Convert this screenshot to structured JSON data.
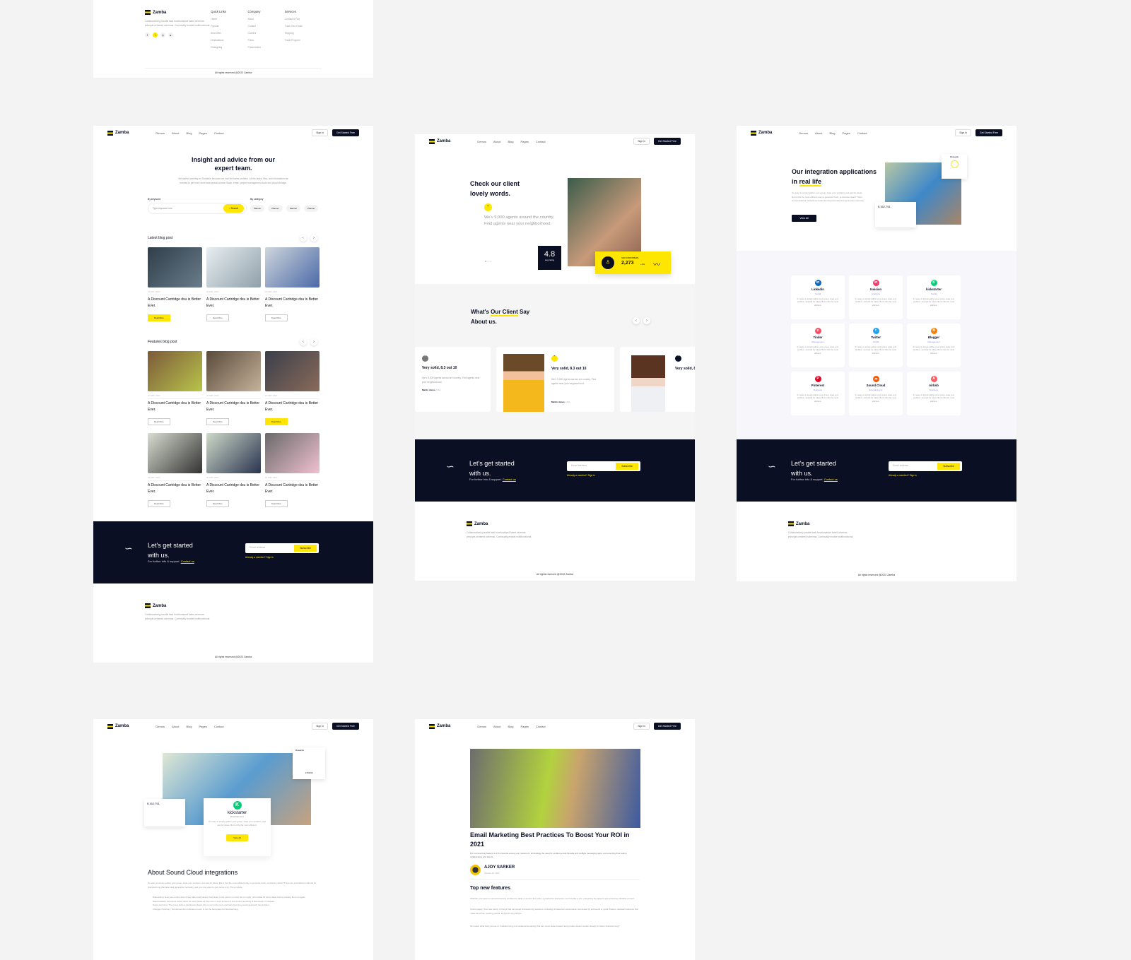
{
  "brand": "Zamba",
  "nav": {
    "links": [
      "Demos",
      "About",
      "Blog",
      "Pages",
      "Contact"
    ],
    "sign_in": "Sign in",
    "get_started": "Get Started Free"
  },
  "footer": {
    "desc": "Collaboratively parallel task functionalized talent whereas principle-centered schemas. Continually enable multifunctional.",
    "socials": [
      "f",
      "t",
      "ig",
      "yt"
    ],
    "cols": [
      {
        "title": "Quick Links",
        "items": [
          "Home",
          "Popular",
          "Best Offer",
          "Destinations",
          "Changelog"
        ]
      },
      {
        "title": "Company",
        "items": [
          "About",
          "Contact",
          "Careers",
          "Press",
          "Presentation"
        ]
      },
      {
        "title": "Services",
        "items": [
          "Contact & Faq",
          "Track Your Order",
          "Shipping",
          "Trade Program"
        ]
      }
    ],
    "copyright": "All rights reserved @2022 Zamba"
  },
  "cta": {
    "title_line1": "Let's get started",
    "title_line2": "with us.",
    "support": "For furthur info & support.",
    "contact_link": "Contact us",
    "email_placeholder": "Email address",
    "subscribe": "Subscribe",
    "member": "Already a member? Sign in"
  },
  "blog": {
    "title": "Insight and advice from our expert team.",
    "desc": "We started working on Taskable because we had the same problem. All the tasks, files, and information we needed to get work done was spread across Slack, email, project management tools and cloud storage.",
    "by_keyword": "By keyword",
    "keyword_placeholder": "Type keyword here",
    "search": "Search",
    "by_category": "By category",
    "categories": [
      "Planner",
      "Planner",
      "Planner",
      "Planner"
    ],
    "latest_title": "Latest blog post",
    "features_title": "Features blog post",
    "post_date": "22 APR, 2020",
    "post_title": "A Discount Cartridge dsu is Better Ever.",
    "read_more": "Read More"
  },
  "testimonials": {
    "hero_title": "Check our client lovely words.",
    "hero_quote": "We'v 9,000 agents around the country, Find agents near your neighborhood.",
    "rating": "4.8",
    "rating_label": "avg rating",
    "subs_label": "New subscribers",
    "subs_value": "2,273",
    "subs_change": "+4%",
    "section_title_a": "What's ",
    "section_title_hl": "Our Client",
    "section_title_b": " Say About us.",
    "card_title": "Very solid, 8.3 out 10",
    "card_text": "We'v 9,000 agents across are country, Find agents near your neighborhood.",
    "card_author": "Martin Jones,",
    "card_loc": "USA"
  },
  "integrations": {
    "title_a": "Our integration applications in ",
    "title_hl": "real life",
    "desc": "It's easy to simply gather your group, state your problem, and ask for ideas. But is this the most efficient way to generate fresh, productive ideas? There are specialized methods for brainstorming that take idea generation seriously.",
    "view_all": "View All",
    "stat": "$ 162,751",
    "rewards": "Rewards",
    "reward_value": "170,833",
    "card_desc": "It's easy to simply gather your group, state your problem, and ask for ideas. But is this the most efficient.",
    "apps": [
      {
        "name": "Linkedin",
        "cat": "Social",
        "color": "#0a66c2",
        "glyph": "in"
      },
      {
        "name": "Invision",
        "cat": "Analytics",
        "color": "#ff3366",
        "glyph": "in"
      },
      {
        "name": "kickstarter",
        "cat": "Social",
        "color": "#05ce78",
        "glyph": "K"
      },
      {
        "name": "Tinder",
        "cat": "Management",
        "color": "#fd5068",
        "glyph": "♥"
      },
      {
        "name": "Twitter",
        "cat": "Social",
        "color": "#1da1f2",
        "glyph": "t"
      },
      {
        "name": "Blogger",
        "cat": "Management",
        "color": "#f57d00",
        "glyph": "B"
      },
      {
        "name": "Pinterest",
        "cat": "Business",
        "color": "#e60023",
        "glyph": "P"
      },
      {
        "name": "Sound Cloud",
        "cat": "Entertainment",
        "color": "#ff5500",
        "glyph": "☁"
      },
      {
        "name": "Airbnb",
        "cat": "Business",
        "color": "#ff5a5f",
        "glyph": "A"
      }
    ]
  },
  "detail": {
    "app": "kickstarter",
    "cat": "Entertainment",
    "about_title": "About Sound Cloud integrations",
    "about_text": "It's easy to simply gather your group, state your problem, and ask for ideas. But is this the most efficient way to generate fresh, productive ideas? There are specialized methods for brainstorming that take idea generation seriously, and you may want to give some a try. They include:",
    "bullets": [
      "Brainwriting: Everyone writes down three ideas and passes their ideas to the person on their left (or right), who builds off those ideas before passing them on again.",
      "Rapid ideation: Everyone writes down as many ideas as they can in a set amount of time before anything is discussed or critiqued.",
      "Figure storming: The group picks a well-known figure who is not in the room and asks how they would approach the problem.",
      "Change of scenery: Sometimes the conference room is not the best place for brainstorming."
    ]
  },
  "article": {
    "title": "Email Marketing Best Practices To Boost Your ROI in 2021",
    "lead": "Our commenting feature is a firm favorite among our customers, eliminating the need for endless email threads and multiple messaging apps, and ensuring their teams, collaborators and clients.",
    "author": "AJOY SARKER",
    "date": "October 26, 2021",
    "sub_title": "Top new features",
    "p1": "Whether your team is spread around a conference table or around the world, a productive brainstorm can feel like a win, energizing the players and producing valuable content.",
    "p2": "Unfortunately, there are plenty of things that can derail brainstorming sessions, including unbalanced conversation dominated by extroverts or quick thinkers, awkward silences that make the whole meeting painful, and anchoring effects.",
    "p3": "No matter what field you are in, brainstorming is a fundamental activity that can move ideas forward and produce better results. Ready for better brainstorming?"
  }
}
